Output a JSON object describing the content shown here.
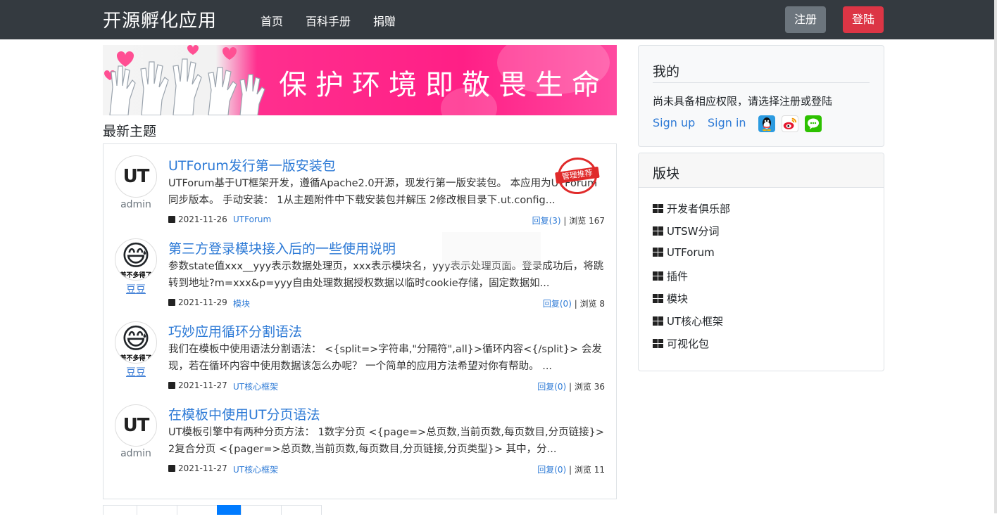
{
  "navbar": {
    "brand": "开源孵化应用",
    "links": [
      "首页",
      "百科手册",
      "捐赠"
    ],
    "register_label": "注册",
    "login_label": "登陆"
  },
  "banner": {
    "text": "保护环境即敬畏生命"
  },
  "latest": {
    "title": "最新主题",
    "stamp": "管理推荐",
    "topics": [
      {
        "author": "admin",
        "avatar": "UT",
        "title": "UTForum发行第一版安装包",
        "excerpt": "UTForum基于UT框架开发，遵循Apache2.0开源，现发行第一版安装包。 本应用为UTForum同步版本。 手动安装： 1从主题附件中下载安装包并解压 2修改根目录下.ut.config...",
        "date": "2021-11-26",
        "category": "UTForum",
        "replies": "回复(3)",
        "views": " | 浏览 167"
      },
      {
        "author": "豆豆",
        "avatar": "😅",
        "avatar_caption": "差不多得了",
        "title": "第三方登录模块接入后的一些使用说明",
        "excerpt": "参数state值xxx__yyy表示数据处理页，xxx表示模块名，yyy表示处理页面。登录成功后，将跳转到地址?m=xxx&p=yyy自由处理数据授权数据以临时cookie存储，固定数据如...",
        "date": "2021-11-29",
        "category": "模块",
        "replies": "回复(0)",
        "views": " | 浏览 8"
      },
      {
        "author": "豆豆",
        "avatar": "😅",
        "avatar_caption": "差不多得了",
        "title": "巧妙应用循环分割语法",
        "excerpt": "我们在模板中使用语法分割语法： <{split=>字符串,\"分隔符\",all}>循环内容<{/split}> 会发现，若在循环内容中使用数据该怎么办呢？ 一个简单的应用方法希望对你有帮助。 ...",
        "date": "2021-11-27",
        "category": "UT核心框架",
        "replies": "回复(0)",
        "views": " | 浏览 36"
      },
      {
        "author": "admin",
        "avatar": "UT",
        "title": "在模板中使用UT分页语法",
        "excerpt": "UT模板引擎中有两种分页方法： 1数字分页 <{page=>总页数,当前页数,每页数目,分页链接}> 2复合分页 <{pager=>总页数,当前页数,每页数目,分页链接,分页类型}> 其中，分...",
        "date": "2021-11-27",
        "category": "UT核心框架",
        "replies": "回复(0)",
        "views": " | 浏览 11"
      }
    ]
  },
  "sidebar": {
    "mine": {
      "title": "我的",
      "text": "尚未具备相应权限，请选择注册或登陆",
      "signup": "Sign up",
      "signin": "Sign in",
      "social_icons": [
        "qq-icon",
        "weibo-icon",
        "wechat-icon"
      ]
    },
    "boards": {
      "title": "版块",
      "items": [
        "开发者俱乐部",
        "UTSW分词",
        "UTForum",
        "插件",
        "模块",
        "UT核心框架",
        "可视化包"
      ]
    }
  },
  "colors": {
    "navbar": "#343a40",
    "link": "#2d7ad6",
    "register": "#6c757d",
    "login": "#dc3545",
    "banner": "#ff1f86"
  }
}
